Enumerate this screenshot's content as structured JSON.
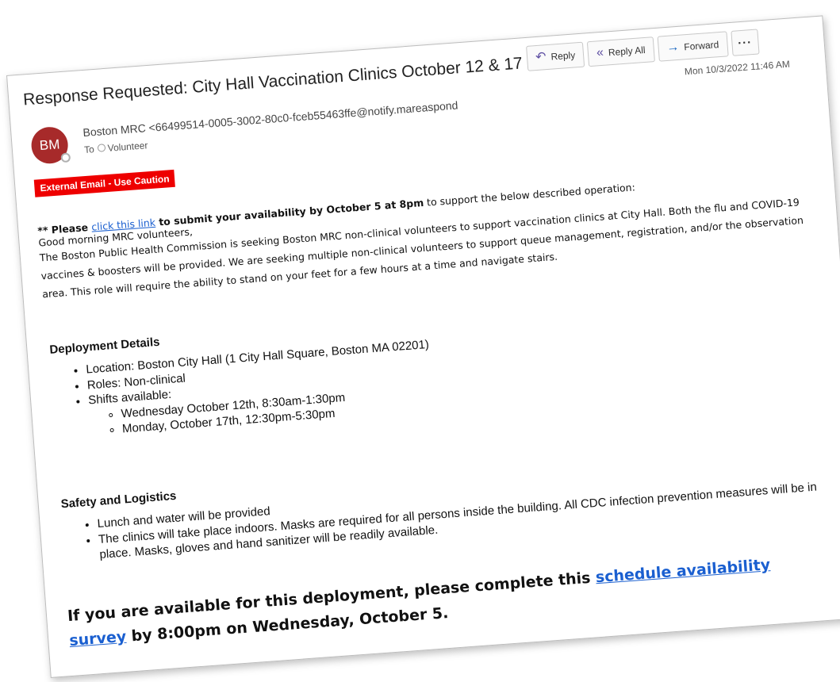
{
  "email": {
    "subject": "Response Requested: City Hall Vaccination Clinics October 12 & 17",
    "actions": {
      "reply": "Reply",
      "reply_all": "Reply All",
      "forward": "Forward",
      "more": "···"
    },
    "date": "Mon 10/3/2022 11:46 AM",
    "sender": {
      "initials": "BM",
      "display": "Boston MRC <66499514-0005-3002-80c0-fceb55463ffe@notify.mareaspond",
      "to_label": "To",
      "to_value": "Volunteer"
    },
    "banner": "External Email - Use Caution"
  },
  "body": {
    "intro_prefix": "** Please ",
    "intro_link": "click this link",
    "intro_bold": " to submit your availability by October 5 at 8pm",
    "intro_suffix": " to support the below described operation:",
    "greeting": "Good morning MRC volunteers,",
    "paragraph": "The Boston Public Health Commission is seeking Boston MRC non-clinical volunteers to support vaccination clinics at City Hall. Both the flu and COVID-19 vaccines & boosters will be provided. We are seeking multiple non-clinical volunteers to support queue management, registration, and/or the observation area. This role will require the ability to stand on your feet for a few hours at a time and navigate stairs.",
    "deployment": {
      "heading": "Deployment Details",
      "location": "Location: Boston City Hall (1 City Hall Square, Boston MA 02201)",
      "roles": "Roles: Non-clinical",
      "shifts_label": "Shifts available:",
      "shifts": [
        "Wednesday October 12th, 8:30am-1:30pm",
        "Monday, October 17th, 12:30pm-5:30pm"
      ]
    },
    "safety": {
      "heading": "Safety and Logistics",
      "items": [
        "Lunch and water will be provided",
        "The clinics will take place indoors. Masks are required for all persons inside the building.  All CDC infection prevention measures will be in place. Masks, gloves and hand sanitizer will be readily available."
      ]
    },
    "closing": {
      "prefix": "If you are available for this deployment, please complete this ",
      "link": "schedule availability survey",
      "suffix": " by 8:00pm on Wednesday, October 5."
    }
  },
  "colors": {
    "avatar": "#a72a2a",
    "banner": "#ee0000",
    "link": "#1a5fd0",
    "forward_icon": "#1664c0",
    "reply_icon": "#5e4fa3"
  }
}
